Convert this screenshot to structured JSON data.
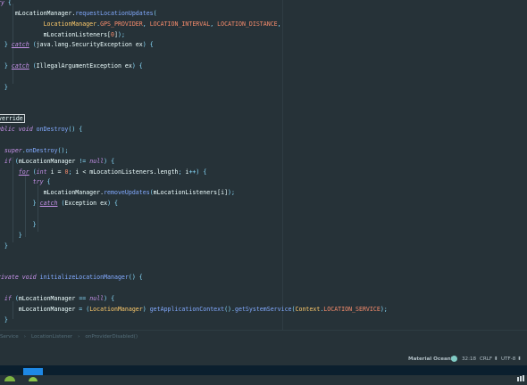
{
  "editor": {
    "lines": [
      [
        [
          "kw",
          "try"
        ],
        [
          "punc",
          " {"
        ]
      ],
      [
        [
          "txt",
          "      mLocationManager."
        ],
        [
          "fn",
          "requestLocationUpdates"
        ],
        [
          "punc",
          "("
        ]
      ],
      [
        [
          "txt",
          "              "
        ],
        [
          "cls",
          "LocationManager"
        ],
        [
          "punc",
          "."
        ],
        [
          "const",
          "GPS_PROVIDER"
        ],
        [
          "punc",
          ", "
        ],
        [
          "const",
          "LOCATION_INTERVAL"
        ],
        [
          "punc",
          ", "
        ],
        [
          "const",
          "LOCATION_DISTANCE"
        ],
        [
          "punc",
          ","
        ]
      ],
      [
        [
          "txt",
          "              mLocationListeners["
        ],
        [
          "num",
          "0"
        ],
        [
          "txt",
          "]"
        ],
        [
          "punc",
          ");"
        ]
      ],
      [
        [
          "punc",
          "   } "
        ],
        [
          "kwu",
          "catch"
        ],
        [
          "punc",
          " ("
        ],
        [
          "txt",
          "java.lang.SecurityException ex"
        ],
        [
          "punc",
          ") {"
        ]
      ],
      [
        [
          "txt",
          ""
        ]
      ],
      [
        [
          "punc",
          "   } "
        ],
        [
          "kwu",
          "catch"
        ],
        [
          "punc",
          " ("
        ],
        [
          "txt",
          "IllegalArgumentException ex"
        ],
        [
          "punc",
          ") {"
        ]
      ],
      [
        [
          "txt",
          ""
        ]
      ],
      [
        [
          "punc",
          "   }"
        ]
      ],
      [
        [
          "punc",
          "}"
        ]
      ],
      [
        [
          "txt",
          ""
        ]
      ],
      [
        [
          "ann",
          "Override"
        ]
      ],
      [
        [
          "kw",
          "public void "
        ],
        [
          "fn",
          "onDestroy"
        ],
        [
          "punc",
          "() {"
        ]
      ],
      [
        [
          "txt",
          ""
        ]
      ],
      [
        [
          "txt",
          "   "
        ],
        [
          "kw",
          "super"
        ],
        [
          "punc",
          "."
        ],
        [
          "fn",
          "onDestroy"
        ],
        [
          "punc",
          "();"
        ]
      ],
      [
        [
          "txt",
          "   "
        ],
        [
          "kw",
          "if"
        ],
        [
          "punc",
          " ("
        ],
        [
          "txt",
          "mLocationManager "
        ],
        [
          "punc",
          "!= "
        ],
        [
          "kw",
          "null"
        ],
        [
          "punc",
          ") {"
        ]
      ],
      [
        [
          "txt",
          "       "
        ],
        [
          "kwu",
          "for"
        ],
        [
          "punc",
          " ("
        ],
        [
          "kw",
          "int "
        ],
        [
          "txt",
          "i = "
        ],
        [
          "num",
          "0"
        ],
        [
          "punc",
          "; "
        ],
        [
          "txt",
          "i < mLocationListeners.length"
        ],
        [
          "punc",
          "; "
        ],
        [
          "txt",
          "i"
        ],
        [
          "punc",
          "++) {"
        ]
      ],
      [
        [
          "txt",
          "           "
        ],
        [
          "kw",
          "try"
        ],
        [
          "punc",
          " {"
        ]
      ],
      [
        [
          "txt",
          "              mLocationManager."
        ],
        [
          "fn",
          "removeUpdates"
        ],
        [
          "punc",
          "("
        ],
        [
          "txt",
          "mLocationListeners[i]"
        ],
        [
          "punc",
          ");"
        ]
      ],
      [
        [
          "punc",
          "           } "
        ],
        [
          "kwu",
          "catch"
        ],
        [
          "punc",
          " ("
        ],
        [
          "txt",
          "Exception ex"
        ],
        [
          "punc",
          ") {"
        ]
      ],
      [
        [
          "txt",
          ""
        ]
      ],
      [
        [
          "punc",
          "           }"
        ]
      ],
      [
        [
          "punc",
          "       }"
        ]
      ],
      [
        [
          "punc",
          "   }"
        ]
      ],
      [
        [
          "punc",
          "}"
        ]
      ],
      [
        [
          "txt",
          ""
        ]
      ],
      [
        [
          "kw",
          "private void "
        ],
        [
          "fn",
          "initializeLocationManager"
        ],
        [
          "punc",
          "() {"
        ]
      ],
      [
        [
          "txt",
          ""
        ]
      ],
      [
        [
          "txt",
          "   "
        ],
        [
          "kw",
          "if"
        ],
        [
          "punc",
          " ("
        ],
        [
          "txt",
          "mLocationManager "
        ],
        [
          "punc",
          "== "
        ],
        [
          "kw",
          "null"
        ],
        [
          "punc",
          ") {"
        ]
      ],
      [
        [
          "txt",
          "       mLocationManager "
        ],
        [
          "punc",
          "= ("
        ],
        [
          "cls",
          "LocationManager"
        ],
        [
          "punc",
          ") "
        ],
        [
          "fn",
          "getApplicationContext"
        ],
        [
          "punc",
          "()."
        ],
        [
          "fn",
          "getSystemService"
        ],
        [
          "punc",
          "("
        ],
        [
          "cls",
          "Context"
        ],
        [
          "punc",
          "."
        ],
        [
          "const",
          "LOCATION_SERVICE"
        ],
        [
          "punc",
          ");"
        ]
      ],
      [
        [
          "punc",
          "   }"
        ]
      ],
      [
        [
          "punc",
          "}"
        ]
      ]
    ]
  },
  "breadcrumb": [
    "Service",
    "LocationListener",
    "onProviderDisabled()"
  ],
  "statusbar": {
    "theme": "Material Oceanic",
    "position": "32:18",
    "line_separator": "CRLF",
    "encoding": "UTF-8"
  }
}
